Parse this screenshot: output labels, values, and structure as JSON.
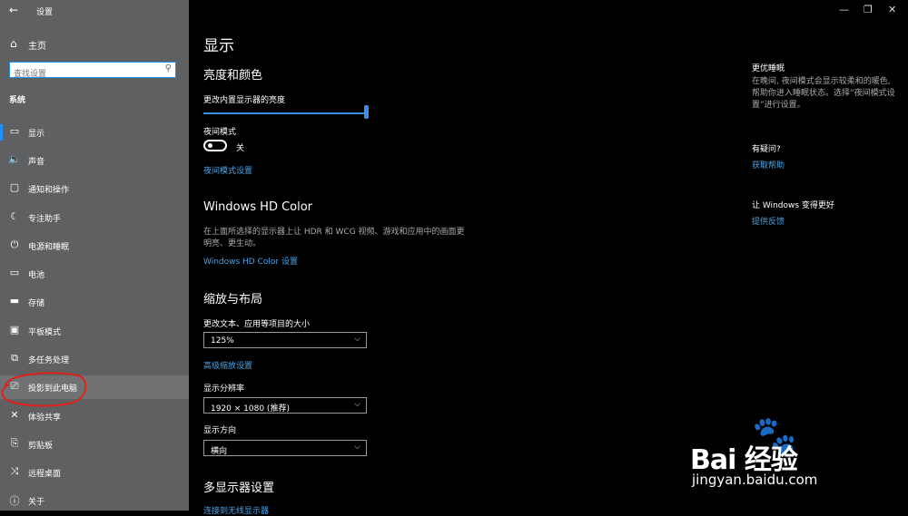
{
  "window": {
    "title": "设置",
    "minimize": "—",
    "maximize": "❐",
    "close": "✕"
  },
  "sidebar": {
    "back_icon": "←",
    "home": {
      "icon": "⌂",
      "label": "主页"
    },
    "search": {
      "placeholder": "查找设置",
      "icon": "⚲"
    },
    "section": "系统",
    "items": [
      {
        "icon": "▭",
        "label": "显示"
      },
      {
        "icon": "🔈",
        "label": "声音"
      },
      {
        "icon": "▢",
        "label": "通知和操作"
      },
      {
        "icon": "☾",
        "label": "专注助手"
      },
      {
        "icon": "⏻",
        "label": "电源和睡眠"
      },
      {
        "icon": "▭",
        "label": "电池"
      },
      {
        "icon": "▬",
        "label": "存储"
      },
      {
        "icon": "▣",
        "label": "平板模式"
      },
      {
        "icon": "⧉",
        "label": "多任务处理"
      },
      {
        "icon": "⎚",
        "label": "投影到此电脑"
      },
      {
        "icon": "✕",
        "label": "体验共享"
      },
      {
        "icon": "⎘",
        "label": "剪贴板"
      },
      {
        "icon": "⤨",
        "label": "远程桌面"
      },
      {
        "icon": "ⓘ",
        "label": "关于"
      }
    ]
  },
  "main": {
    "title": "显示",
    "brightness": {
      "heading": "亮度和颜色",
      "label": "更改内置显示器的亮度",
      "value": 100
    },
    "night_light": {
      "label": "夜间模式",
      "state": "关",
      "link": "夜间模式设置"
    },
    "hdr": {
      "heading": "Windows HD Color",
      "desc": "在上面所选择的显示器上让 HDR 和 WCG 视频、游戏和应用中的画面更明亮、更生动。",
      "link": "Windows HD Color 设置"
    },
    "scale": {
      "heading": "缩放与布局",
      "label": "更改文本、应用等项目的大小",
      "value": "125%",
      "link": "高级缩放设置"
    },
    "resolution": {
      "label": "显示分辨率",
      "value": "1920 × 1080 (推荐)"
    },
    "orientation": {
      "label": "显示方向",
      "value": "横向"
    },
    "multi": {
      "heading": "多显示器设置",
      "link": "连接到无线显示器"
    }
  },
  "right": {
    "sleep_title": "更优睡眠",
    "sleep_desc": "在晚间, 夜间模式会显示较柔和的暖色, 帮助你进入睡眠状态。选择“夜间模式设置”进行设置。",
    "question_title": "有疑问?",
    "help_link": "获取帮助",
    "improve_title": "让 Windows 变得更好",
    "feedback_link": "提供反馈"
  },
  "watermark": {
    "logo": "Bai 经验",
    "url": "jingyan.baidu.com"
  },
  "colors": {
    "sidebar": "#5f6062",
    "accent": "#1e90ff",
    "link": "#4aa3e6",
    "annotation": "#e0201b"
  }
}
